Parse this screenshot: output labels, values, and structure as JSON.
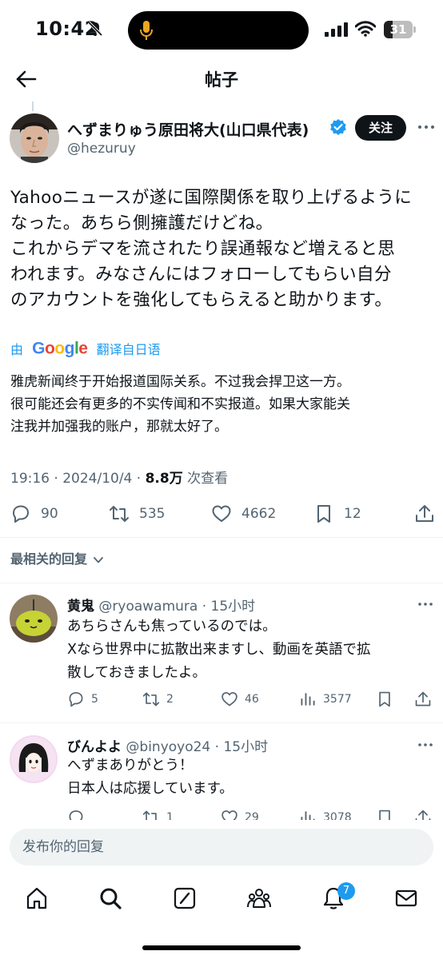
{
  "status_bar": {
    "time": "10:42",
    "battery": "31",
    "battery_level": 0.31
  },
  "header": {
    "title": "帖子"
  },
  "post": {
    "author_name": "へずまりゅう原田将大(山口県代表)",
    "author_handle": "@hezuruy",
    "follow_label": "关注",
    "text": "Yahooニュースが遂に国際関係を取り上げるように\nなった。あちら側擁護だけどね。\nこれからデマを流されたり誤通報など増えると思\nわれます。みなさんにはフォローしてもらい自分\nのアカウントを強化してもらえると助かります。",
    "translate_prefix": "由",
    "translate_brand": "Google",
    "translate_suffix": "翻译自日语",
    "translated_text": "雅虎新闻终于开始报道国际关系。不过我会捍卫这一方。\n很可能还会有更多的不实传闻和不实报道。如果大家能关\n注我并加强我的账户，那就太好了。",
    "timestamp": "19:16 · 2024/10/4 · ",
    "views": "8.8万",
    "views_label": " 次查看",
    "replies": "90",
    "reposts": "535",
    "likes": "4662",
    "bookmarks": "12"
  },
  "sort_label": "最相关的回复",
  "replies": [
    {
      "name": "黄鬼",
      "handle": " @ryoawamura · 15小时",
      "text": "あちらさんも焦っているのでは。\nXなら世界中に拡散出来ますし、動画を英語で拡\n散しておきましたよ。",
      "replies": "5",
      "reposts": "2",
      "likes": "46",
      "views": "3577"
    },
    {
      "name": "びんよよ",
      "handle": " @binyoyo24 · 15小时",
      "text": "へずまありがとう！\n日本人は応援しています。",
      "replies": "",
      "reposts": "1",
      "likes": "29",
      "views": "3078"
    }
  ],
  "compose": {
    "placeholder": "发布你的回复"
  },
  "tabbar": {
    "notifications_badge": "7"
  },
  "colors": {
    "accent": "#1d9bf0",
    "text": "#0f1419",
    "muted": "#536471"
  }
}
